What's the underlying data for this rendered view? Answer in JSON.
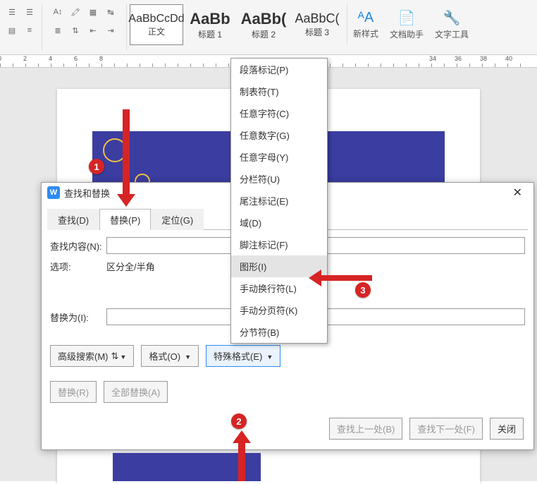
{
  "toolbar": {
    "style_normal_prev": "AaBbCcDd",
    "style_normal": "正文",
    "style_h1_prev": "AaBb",
    "style_h1": "标题 1",
    "style_h2_prev": "AaBb(",
    "style_h2": "标题 2",
    "style_h3_prev": "AaBbC(",
    "style_h3": "标题 3",
    "new_style": "新样式",
    "doc_helper": "文档助手",
    "text_tools": "文字工具"
  },
  "ruler_marks": [
    "2",
    "4",
    "6",
    "8",
    "",
    "",
    "",
    "",
    "",
    "",
    "",
    "",
    "",
    "",
    "",
    "",
    "",
    "",
    "",
    "",
    "",
    "",
    "",
    "",
    "",
    "",
    "",
    "34",
    "36",
    "38",
    "40"
  ],
  "dialog": {
    "title": "查找和替换",
    "tab_find": "查找(D)",
    "tab_replace": "替换(P)",
    "tab_goto": "定位(G)",
    "find_label": "查找内容(N):",
    "find_value": "",
    "option_label": "选项:",
    "option_value": "区分全/半角",
    "replace_label": "替换为(I):",
    "replace_value": "",
    "btn_advanced": "高级搜索(M)",
    "btn_format": "格式(O)",
    "btn_special": "特殊格式(E)",
    "btn_replace": "替换(R)",
    "btn_replace_all": "全部替换(A)",
    "btn_find_prev": "查找上一处(B)",
    "btn_find_next": "查找下一处(F)",
    "btn_close": "关闭"
  },
  "menu_items": [
    "段落标记(P)",
    "制表符(T)",
    "任意字符(C)",
    "任意数字(G)",
    "任意字母(Y)",
    "分栏符(U)",
    "尾注标记(E)",
    "域(D)",
    "脚注标记(F)",
    "图形(I)",
    "手动换行符(L)",
    "手动分页符(K)",
    "分节符(B)"
  ],
  "menu_highlight_index": 9,
  "annotations": {
    "1": "1",
    "2": "2",
    "3": "3"
  }
}
